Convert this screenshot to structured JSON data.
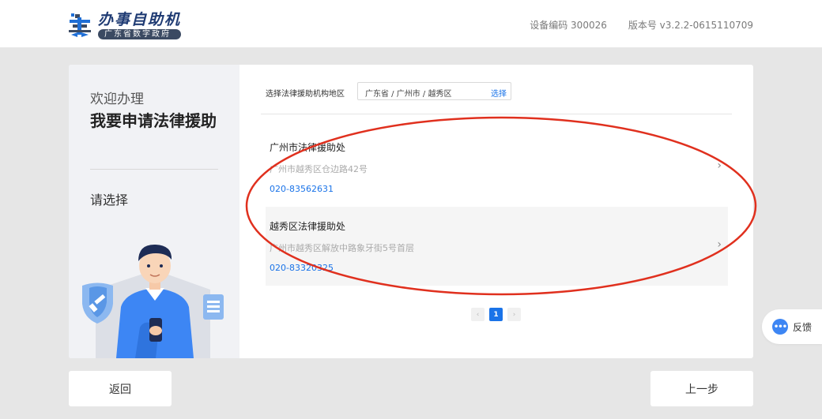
{
  "header": {
    "app_title": "办事自助机",
    "app_subtitle": "广东省数字政府",
    "device_code": "设备编码 300026",
    "version": "版本号 v3.2.2-0615110709"
  },
  "sidebar": {
    "welcome": "欢迎办理",
    "service_title": "我要申请法律援助",
    "prompt": "请选择"
  },
  "region": {
    "label": "选择法律援助机构地区",
    "value": "广东省 / 广州市 / 越秀区",
    "select_label": "选择"
  },
  "offices": [
    {
      "name": "广州市法律援助处",
      "address": "广州市越秀区仓边路42号",
      "phone": "020-83562631"
    },
    {
      "name": "越秀区法律援助处",
      "address": "广州市越秀区解放中路象牙街5号首层",
      "phone": "020-83320325"
    }
  ],
  "pagination": {
    "prev": "‹",
    "current": "1",
    "next": "›"
  },
  "footer": {
    "back_label": "返回",
    "prev_step_label": "上一步"
  },
  "feedback": {
    "label": "反馈",
    "icon": "chat-dots-icon"
  },
  "colors": {
    "accent": "#1a73e8",
    "annotation": "#e0301e",
    "brand_dark": "#1f3b73"
  }
}
